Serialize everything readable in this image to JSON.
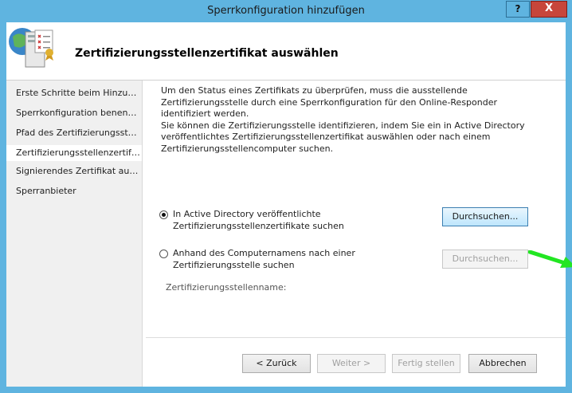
{
  "window": {
    "title": "Sperrkonfiguration hinzufügen",
    "help_label": "?",
    "close_label": "X"
  },
  "header": {
    "title": "Zertifizierungsstellenzertifikat auswählen"
  },
  "sidebar": {
    "items": [
      {
        "label": "Erste Schritte beim Hinzu…"
      },
      {
        "label": "Sperrkonfiguration benen…"
      },
      {
        "label": "Pfad des Zertifizierungsst…"
      },
      {
        "label": "Zertifizierungsstellenzertif…",
        "active": true
      },
      {
        "label": "Signierendes Zertifikat au…"
      },
      {
        "label": "Sperranbieter"
      }
    ]
  },
  "main": {
    "description": [
      "Um den Status eines Zertifikats zu überprüfen, muss die ausstellende Zertifizierungsstelle durch eine Sperrkonfiguration für den Online-Responder identifiziert werden.",
      "Sie können die Zertifizierungsstelle identifizieren, indem Sie ein in Active Directory veröffentlichtes Zertifizierungsstellenzertifikat auswählen oder nach einem Zertifizierungsstellencomputer suchen."
    ],
    "option_ad": {
      "label": "In Active Directory veröffentlichte Zertifizierungsstellenzertifikate suchen",
      "checked": true,
      "browse_label": "Durchsuchen..."
    },
    "option_computer": {
      "label": "Anhand des Computernamens nach einer Zertifizierungsstelle suchen",
      "checked": false,
      "browse_label": "Durchsuchen..."
    },
    "ca_name_label": "Zertifizierungsstellenname:"
  },
  "footer": {
    "back_label": "< Zurück",
    "next_label": "Weiter >",
    "finish_label": "Fertig stellen",
    "cancel_label": "Abbrechen"
  },
  "colors": {
    "titlebar": "#5fb4e0",
    "close": "#c7463b",
    "annotation_arrow": "#22e622"
  }
}
